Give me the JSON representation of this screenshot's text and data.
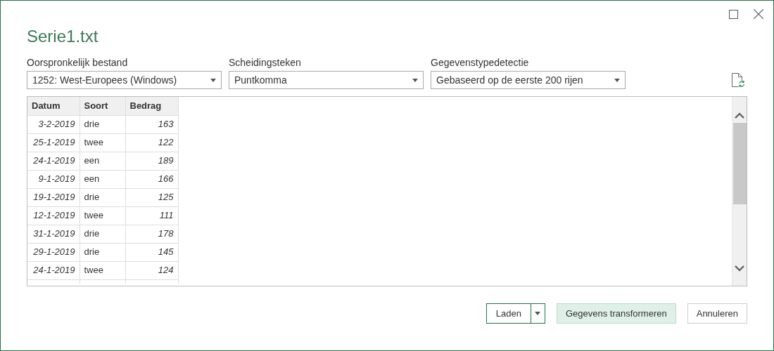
{
  "window": {
    "title": "Serie1.txt"
  },
  "fields": [
    {
      "label": "Oorspronkelijk bestand",
      "value": "1252: West-Europees (Windows)"
    },
    {
      "label": "Scheidingsteken",
      "value": "Puntkomma"
    },
    {
      "label": "Gegevenstypedetectie",
      "value": "Gebaseerd op de eerste 200 rijen"
    }
  ],
  "table": {
    "columns": [
      "Datum",
      "Soort",
      "Bedrag"
    ],
    "rows": [
      [
        "3-2-2019",
        "drie",
        "163"
      ],
      [
        "25-1-2019",
        "twee",
        "122"
      ],
      [
        "24-1-2019",
        "een",
        "189"
      ],
      [
        "9-1-2019",
        "een",
        "166"
      ],
      [
        "19-1-2019",
        "drie",
        "125"
      ],
      [
        "12-1-2019",
        "twee",
        "111"
      ],
      [
        "31-1-2019",
        "drie",
        "178"
      ],
      [
        "29-1-2019",
        "drie",
        "145"
      ],
      [
        "24-1-2019",
        "twee",
        "124"
      ]
    ]
  },
  "buttons": [
    {
      "label": "Laden",
      "kind": "split"
    },
    {
      "label": "Gegevens transformeren",
      "kind": "primary"
    },
    {
      "label": "Annuleren",
      "kind": "default"
    }
  ]
}
